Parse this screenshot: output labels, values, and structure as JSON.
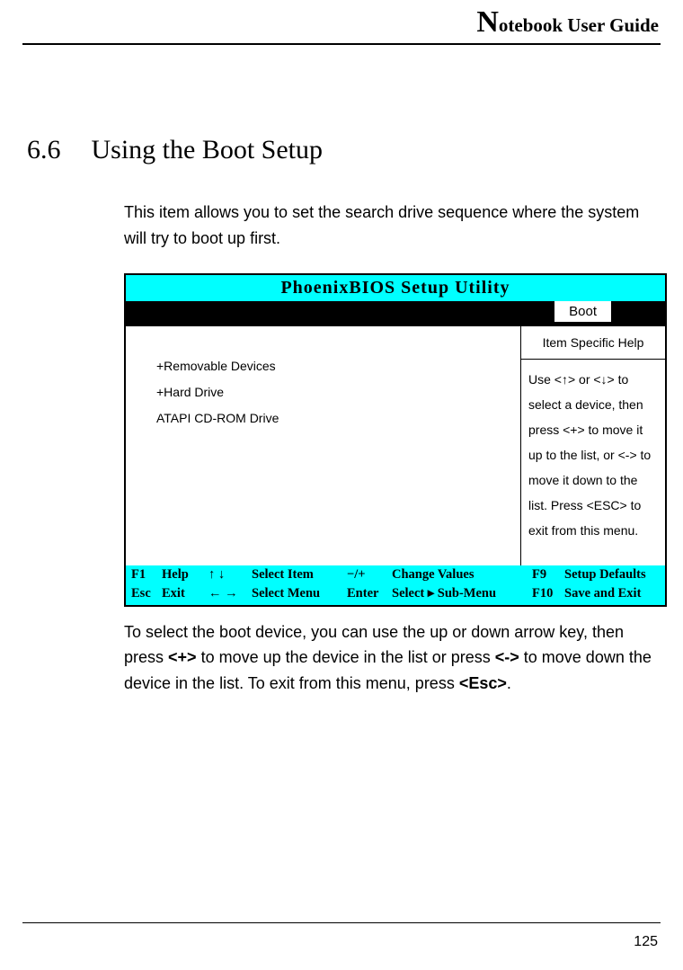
{
  "header": {
    "title": "otebook User Guide"
  },
  "section": {
    "number": "6.6",
    "title": "Using the Boot Setup",
    "intro": "This item allows you to set the search drive sequence where the system will try to boot up first.",
    "outro_parts": [
      "To select the boot device, you can use the up or down arrow key, then press ",
      "<+>",
      " to move up the device in the list or press ",
      "<->",
      " to move down the device in the list. To exit from this menu, press ",
      "<Esc>",
      "."
    ]
  },
  "bios": {
    "title": "PhoenixBIOS Setup Utility",
    "tab": "Boot",
    "devices": [
      "+Removable Devices",
      "+Hard Drive",
      " ATAPI CD-ROM Drive"
    ],
    "help_header": "Item Specific Help",
    "help_body": "Use <↑> or <↓> to select a device, then press <+> to move it up to the list, or <-> to move it down to the list. Press <ESC> to exit from this menu.",
    "footer": {
      "row1": {
        "k1": "F1",
        "l1": "Help",
        "arrows": "↑ ↓",
        "sel": "Select Item",
        "ck": "−/+",
        "cl": "Change Values",
        "fk": "F9",
        "fr": "Setup Defaults"
      },
      "row2": {
        "k1": "Esc",
        "l1": "Exit",
        "arrows": "← →",
        "sel": "Select Menu",
        "ck": "Enter",
        "cl": "Select  ▸ Sub-Menu",
        "fk": "F10",
        "fr": "Save and Exit"
      }
    }
  },
  "page_number": "125"
}
